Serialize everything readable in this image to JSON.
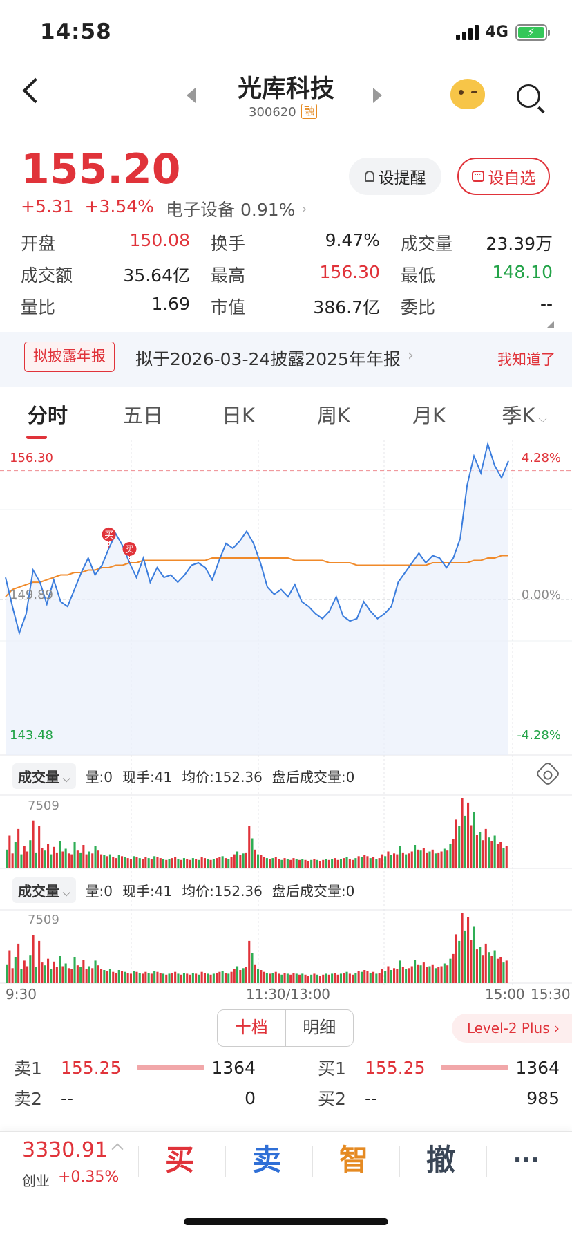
{
  "status_bar": {
    "time": "14:58",
    "network": "4G",
    "battery_icon": "battery-charging-icon"
  },
  "header": {
    "name": "光库科技",
    "code": "300620",
    "tag": "融"
  },
  "quote": {
    "price": "155.20",
    "change": "+5.31",
    "change_pct": "+3.54%",
    "sector": "电子设备",
    "sector_pct": "0.91%",
    "remind_label": "设提醒",
    "fav_label": "设自选"
  },
  "stats": [
    [
      {
        "label": "开盘",
        "value": "150.08",
        "color": "red"
      },
      {
        "label": "换手",
        "value": "9.47%",
        "color": "dark"
      },
      {
        "label": "成交量",
        "value": "23.39万",
        "color": "dark"
      }
    ],
    [
      {
        "label": "成交额",
        "value": "35.64亿",
        "color": "dark"
      },
      {
        "label": "最高",
        "value": "156.30",
        "color": "red"
      },
      {
        "label": "最低",
        "value": "148.10",
        "color": "green"
      }
    ],
    [
      {
        "label": "量比",
        "value": "1.69",
        "color": "dark"
      },
      {
        "label": "市值",
        "value": "386.7亿",
        "color": "dark"
      },
      {
        "label": "委比",
        "value": "--",
        "color": "dark"
      }
    ]
  ],
  "notice": {
    "tag": "拟披露年报",
    "text": "拟于2026-03-24披露2025年年报",
    "close": "我知道了"
  },
  "tabs": [
    "分时",
    "五日",
    "日K",
    "周K",
    "月K",
    "季K"
  ],
  "chart_labels": {
    "price_high": "156.30",
    "price_prev": "149.89",
    "price_low": "143.48",
    "pct_high": "4.28%",
    "pct_zero": "0.00%",
    "pct_low": "-4.28%",
    "buy_marker": "买",
    "vol_max": "7509",
    "time_start": "9:30",
    "time_mid": "11:30/13:00",
    "time_close": "15:00",
    "time_end": "15:30"
  },
  "volume_header": {
    "selector": "成交量",
    "volume": "量:0",
    "current": "现手:41",
    "avg_price": "均价:152.36",
    "after_hours": "盘后成交量:0"
  },
  "chart_data": {
    "type": "line",
    "title": "",
    "xlabel": "",
    "ylabel": "",
    "ylim": [
      143.48,
      156.3
    ],
    "prev_close": 149.89,
    "x_ticks": [
      "9:30",
      "11:30/13:00",
      "15:00",
      "15:30"
    ],
    "series": [
      {
        "values": [
          150.8,
          149.6,
          148.5,
          149.3,
          151.1,
          150.6,
          149.7,
          150.7,
          149.8,
          149.6,
          150.3,
          151.0,
          151.6,
          150.9,
          151.3,
          152.0,
          152.6,
          152.1,
          151.4,
          150.8,
          151.6,
          150.6,
          151.2,
          150.8,
          150.9,
          150.6,
          150.9,
          151.3,
          151.4,
          151.2,
          150.7,
          151.5,
          152.2,
          152.0,
          152.3,
          152.7,
          152.2,
          151.4,
          150.4,
          150.1,
          150.3,
          150.0,
          150.5,
          149.8,
          149.6,
          149.3,
          149.1,
          149.4,
          150.0,
          149.2,
          149.0,
          149.1,
          149.8,
          149.4,
          149.1,
          149.3,
          149.6,
          150.6,
          151.0,
          151.4,
          151.8,
          151.4,
          151.7,
          151.6,
          151.2,
          151.6,
          152.4,
          154.6,
          155.8,
          155.1,
          156.3,
          155.4,
          154.9,
          155.6
        ]
      },
      {
        "values": [
          150.0,
          150.3,
          150.4,
          150.5,
          150.6,
          150.6,
          150.7,
          150.8,
          150.9,
          150.9,
          151.0,
          151.0,
          151.1,
          151.1,
          151.2,
          151.2,
          151.3,
          151.3,
          151.4,
          151.4,
          151.5,
          151.5,
          151.5,
          151.5,
          151.5,
          151.5,
          151.5,
          151.5,
          151.5,
          151.5,
          151.6,
          151.6,
          151.6,
          151.6,
          151.6,
          151.6,
          151.6,
          151.6,
          151.6,
          151.6,
          151.6,
          151.6,
          151.5,
          151.5,
          151.5,
          151.5,
          151.5,
          151.4,
          151.4,
          151.4,
          151.4,
          151.3,
          151.3,
          151.3,
          151.3,
          151.3,
          151.3,
          151.3,
          151.3,
          151.3,
          151.3,
          151.3,
          151.4,
          151.4,
          151.4,
          151.4,
          151.4,
          151.4,
          151.5,
          151.5,
          151.6,
          151.6,
          151.7,
          151.7
        ]
      }
    ],
    "volume": [
      2000,
      3500,
      1600,
      2800,
      4200,
      1500,
      2400,
      1800,
      3000,
      5100,
      1700,
      4500,
      2200,
      1900,
      2600,
      1500,
      2300,
      1700,
      2900,
      1800,
      2100,
      1600,
      1500,
      2800,
      1900,
      1700,
      2500,
      1500,
      1800,
      1600,
      2400,
      1900,
      1500,
      1400,
      1300,
      1500,
      1200,
      1100,
      1400,
      1300,
      1200,
      1100,
      1000,
      1300,
      1200,
      1100,
      1000,
      1200,
      1100,
      1000,
      1300,
      1200,
      1100,
      1000,
      900,
      1000,
      1100,
      1200,
      1000,
      900,
      1100,
      1000,
      900,
      1100,
      1000,
      900,
      1200,
      1100,
      1000,
      900,
      1000,
      1100,
      1200,
      1300,
      1100,
      1000,
      1200,
      1500,
      1800,
      1400,
      1600,
      1700,
      4500,
      3200,
      2000,
      1500,
      1400,
      1200,
      1100,
      1000,
      1100,
      1200,
      1000,
      900,
      1100,
      1000,
      900,
      1100,
      1000,
      900,
      1000,
      900,
      800,
      900,
      1000,
      900,
      800,
      900,
      1000,
      900,
      1000,
      1100,
      900,
      1000,
      1100,
      1200,
      1000,
      900,
      1100,
      1300,
      1200,
      1400,
      1300,
      1100,
      1200,
      1000,
      1100,
      1500,
      1300,
      1800,
      1400,
      1600,
      1500,
      2400,
      1700,
      1500,
      1600,
      1800,
      2500,
      2000,
      1900,
      2200,
      1700,
      1800,
      2000,
      1600,
      1700,
      1800,
      2100,
      1900,
      2600,
      3100,
      5200,
      4500,
      7509,
      5600,
      7000,
      4600,
      6000,
      3600,
      3900,
      3000,
      4200,
      3300,
      2900,
      3500,
      2600,
      2800,
      2200,
      2400
    ],
    "order_book": {
      "asks": [
        {
          "level": "卖1",
          "price": "155.25",
          "volume": "1364"
        },
        {
          "level": "卖2",
          "price": "--",
          "volume": "0"
        }
      ],
      "bids": [
        {
          "level": "买1",
          "price": "155.25",
          "volume": "1364"
        },
        {
          "level": "买2",
          "price": "--",
          "volume": "985"
        }
      ]
    }
  },
  "orderbook_ui": {
    "tab_ten": "十档",
    "tab_detail": "明细",
    "level2": "Level-2 Plus"
  },
  "bottom_bar": {
    "index_value": "3330.91",
    "index_name": "创业",
    "index_change": "+0.35%",
    "buy": "买",
    "sell": "卖",
    "smart": "智",
    "cancel": "撤",
    "more": "···"
  },
  "colors": {
    "up": "#e0333a",
    "down": "#23a348",
    "price_line": "#3b7ddd",
    "avg_line": "#f08a2a"
  }
}
